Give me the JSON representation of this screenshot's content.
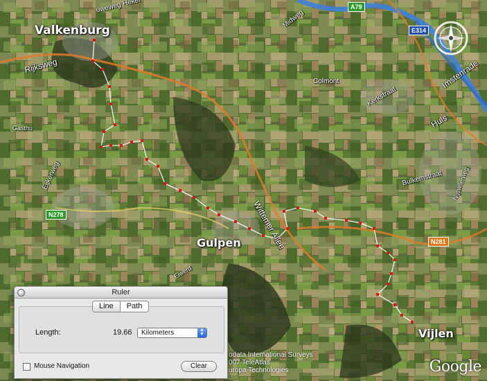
{
  "places": {
    "valkenburg": "Valkenburg",
    "gulpen": "Gulpen",
    "vijlen": "Vijlen"
  },
  "roads": {
    "rijksweg": "Rijksweg",
    "heke": "uweweg  Heker",
    "midweg": "Midweg",
    "colmont": "Colmont",
    "kerkstraat": "Kerkstraat",
    "huls": "Huls",
    "imstenrade": "Imstenrade",
    "gasthu": "Gasthu",
    "eijkerweg": "Eijkerweg",
    "bulkemstraat": "Bulkemstraat",
    "nijswilerweg": "Nijswilerweg",
    "wittemer": "Wittemer Allee",
    "eiwerd": "Eiwerd"
  },
  "shields": {
    "a79": "A79",
    "e314": "E314",
    "n278": "N278",
    "n281": "N281"
  },
  "copyright": {
    "line1": "odata International Surveys",
    "line2": "007 TeleAtlas",
    "line3": "uropa Technologies"
  },
  "logo": "Google",
  "ruler": {
    "title": "Ruler",
    "tabs": [
      "Line",
      "Path"
    ],
    "length_label": "Length:",
    "length_value": "19.66",
    "unit": "Kilometers",
    "mouse_nav_label": "Mouse Navigation",
    "clear_label": "Clear"
  },
  "colors": {
    "path": "#d81818",
    "river": "#3f7fd8",
    "road_orange": "#e07a2a"
  }
}
